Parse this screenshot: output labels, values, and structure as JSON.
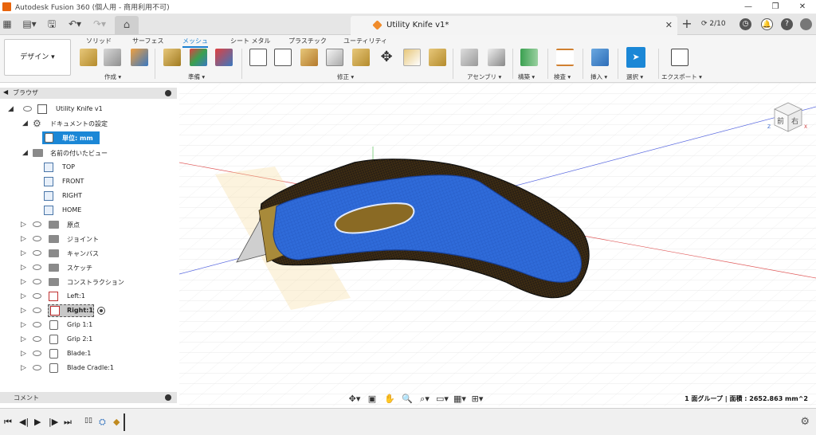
{
  "title_bar": {
    "app_title": "Autodesk Fusion 360 (個人用 - 商用利用不可)"
  },
  "tabs": {
    "document_title": "Utility Knife v1*",
    "jobs_status": "2/10"
  },
  "ribbon": {
    "workspace_button": "デザイン ▾",
    "tabs": [
      "ソリッド",
      "サーフェス",
      "メッシュ",
      "シート メタル",
      "プラスチック",
      "ユーティリティ"
    ],
    "active_tab": "メッシュ",
    "groups": [
      "作成 ▾",
      "準備 ▾",
      "修正 ▾",
      "アセンブリ ▾",
      "構築 ▾",
      "検査 ▾",
      "挿入 ▾",
      "選択 ▾",
      "エクスポート ▾"
    ]
  },
  "browser": {
    "header": "ブラウザ",
    "root": "Utility Knife v1",
    "doc_settings": "ドキュメントの設定",
    "units": "単位: mm",
    "named_views": "名前の付いたビュー",
    "views": [
      "TOP",
      "FRONT",
      "RIGHT",
      "HOME"
    ],
    "folders": [
      "原点",
      "ジョイント",
      "キャンバス",
      "スケッチ",
      "コンストラクション"
    ],
    "components": [
      "Left:1",
      "Right:1"
    ],
    "bodies": [
      "Grip 1:1",
      "Grip 2:1",
      "Blade:1",
      "Blade Cradle:1"
    ]
  },
  "comments": {
    "label": "コメント"
  },
  "status": {
    "text": "1 面グループ | 面積 : 2652.863 mm^2"
  },
  "viewcube": {
    "front": "前",
    "right": "右"
  },
  "colors": {
    "accent": "#1b87d6",
    "mesh_blue": "#2f6bd9",
    "mesh_gold": "#a07a20"
  }
}
